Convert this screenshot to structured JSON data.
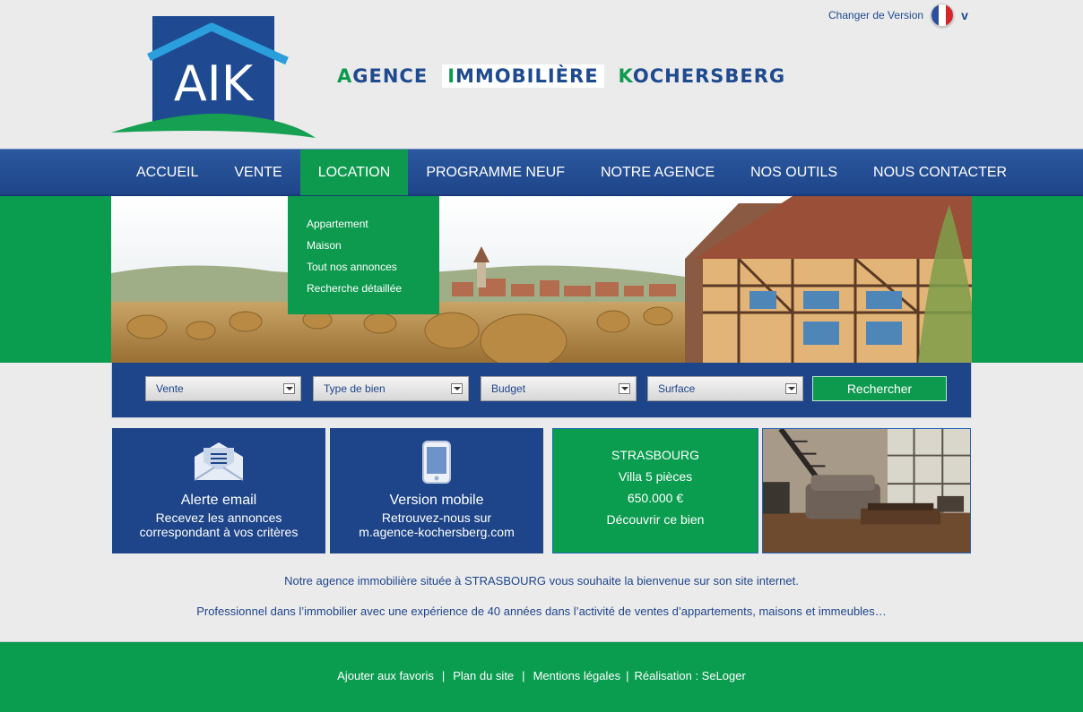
{
  "header": {
    "brand": [
      {
        "cap": "A",
        "rest": "GENCE"
      },
      {
        "cap": "I",
        "rest": "MMOBILIÈRE"
      },
      {
        "cap": "K",
        "rest": "OCHERSBERG"
      }
    ],
    "logo_text": "AIK",
    "version_label": "Changer de Version",
    "version_caret": "v"
  },
  "nav": {
    "items": [
      "ACCUEIL",
      "VENTE",
      "LOCATION",
      "PROGRAMME NEUF",
      "NOTRE AGENCE",
      "NOS OUTILS",
      "NOUS CONTACTER"
    ],
    "active_index": 2
  },
  "dropdown": {
    "items": [
      "Appartement",
      "Maison",
      "Tout nos annonces",
      "Recherche détaillée"
    ]
  },
  "search": {
    "selects": [
      "Vente",
      "Type de bien",
      "Budget",
      "Surface"
    ],
    "button": "Rechercher"
  },
  "tiles": {
    "email": {
      "title": "Alerte email",
      "line1": "Recevez les annonces",
      "line2": "correspondant à vos critères"
    },
    "mobile": {
      "title": "Version mobile",
      "line1": "Retrouvez-nous sur",
      "line2": "m.agence-kochersberg.com"
    },
    "property": {
      "city": "STRASBOURG",
      "type": "Villa 5 pièces",
      "price": "650.000 €",
      "cta": "Découvrir ce bien"
    }
  },
  "intro": {
    "line1": "Notre agence immobilière située à STRASBOURG vous souhaite la bienvenue sur son site internet.",
    "line2": "Professionnel dans l’immobilier avec une expérience de 40 années dans l’activité de ventes d’appartements, maisons et immeubles…"
  },
  "footer": {
    "links": [
      "Ajouter aux favoris",
      "Plan du site",
      "Mentions légales",
      "Réalisation : SeLoger"
    ],
    "separator": "|"
  },
  "colors": {
    "blue": "#1e4589",
    "green": "#0a9c4f",
    "background": "#ebebeb"
  }
}
